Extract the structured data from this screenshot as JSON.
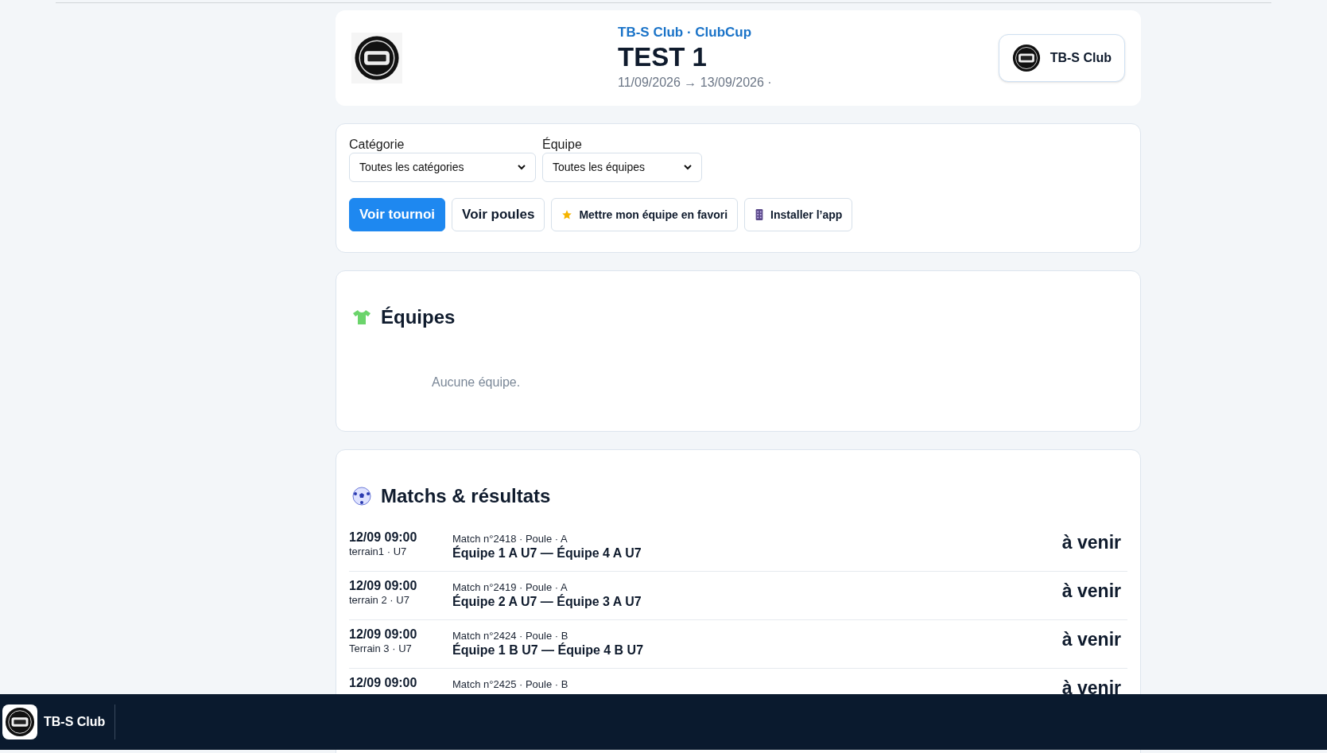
{
  "header": {
    "club_line": "TB-S Club · ClubCup",
    "title": "TEST 1",
    "dates": "11/09/2026 → 13/09/2026 ·",
    "club_button": "TB-S Club"
  },
  "filters": [
    {
      "label": "Catégorie",
      "value": "Toutes les catégories"
    },
    {
      "label": "Équipe",
      "value": "Toutes les équipes"
    }
  ],
  "actions": [
    {
      "label": "Voir tournoi",
      "kind": "primary"
    },
    {
      "label": "Voir poules",
      "kind": "large"
    },
    {
      "label": "Mettre mon équipe en favori",
      "kind": "favorite"
    },
    {
      "label": "Installer l’app",
      "kind": "install"
    }
  ],
  "teams_section": {
    "title": "Équipes",
    "empty": "Aucune équipe."
  },
  "matches_section": {
    "title": "Matchs & résultats",
    "matches": [
      {
        "time": "12/09 09:00",
        "place": "terrain1 · U7",
        "meta": "Match n°2418 · Poule · A",
        "teams": "Équipe 1 A U7 — Équipe 4 A U7",
        "status": "à venir"
      },
      {
        "time": "12/09 09:00",
        "place": "terrain 2 · U7",
        "meta": "Match n°2419 · Poule · A",
        "teams": "Équipe 2 A U7 — Équipe 3 A U7",
        "status": "à venir"
      },
      {
        "time": "12/09 09:00",
        "place": "Terrain 3 · U7",
        "meta": "Match n°2424 · Poule · B",
        "teams": "Équipe 1 B U7 — Équipe 4 B U7",
        "status": "à venir"
      },
      {
        "time": "12/09 09:00",
        "meta": "Match n°2425 · Poule · B",
        "status": "à venir"
      }
    ]
  },
  "bottom_bar": {
    "club": "TB-S Club"
  }
}
